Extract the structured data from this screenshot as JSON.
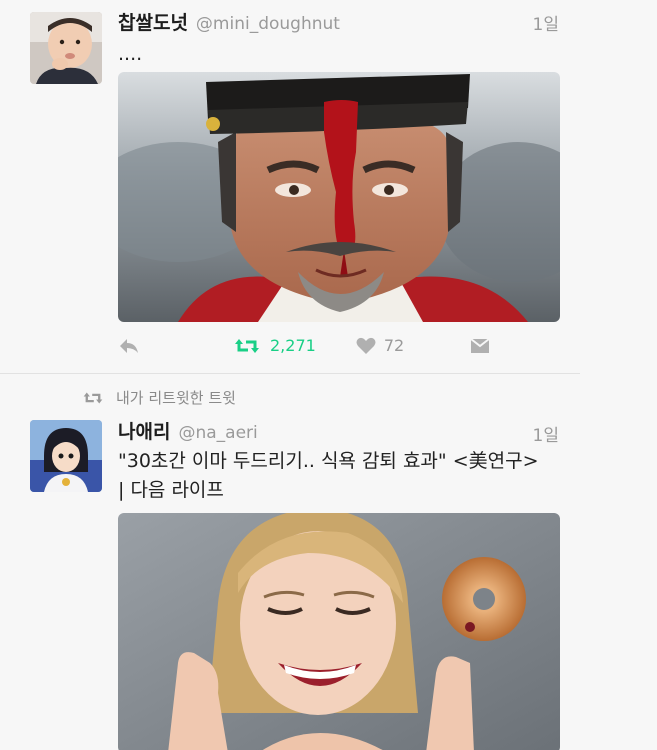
{
  "tweets": [
    {
      "name": "찹쌀도넛",
      "handle": "@mini_doughnut",
      "time": "1일",
      "text": "....",
      "retweets": "2,271",
      "likes": "72"
    },
    {
      "retweet_label": "내가 리트윗한 트윗",
      "name": "나애리",
      "handle": "@na_aeri",
      "time": "1일",
      "text_line1": "\"30초간 이마 두드리기.. 식욕 감퇴 효과\" <美연구>",
      "text_line2": "| 다음 라이프"
    }
  ],
  "colors": {
    "retweet_green": "#19cf86",
    "muted": "#9a9a9a",
    "blood": "#b3121a"
  },
  "icons": [
    "reply-icon",
    "retweet-icon",
    "like-icon",
    "dm-icon",
    "retweeted-by-icon"
  ]
}
